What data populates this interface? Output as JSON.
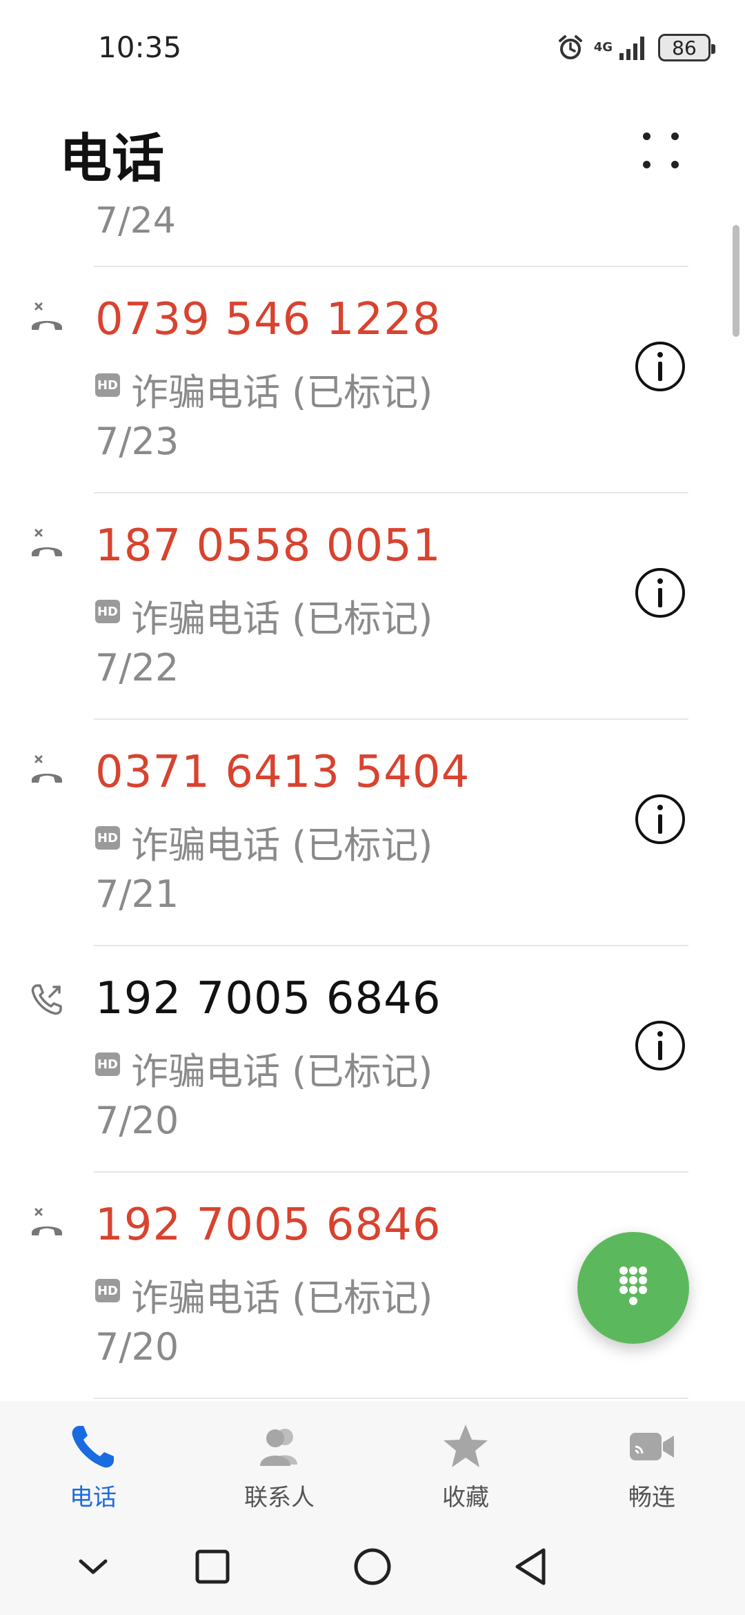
{
  "status_bar": {
    "time": "10:35",
    "network": "4G",
    "battery": "86"
  },
  "header": {
    "title": "电话"
  },
  "call_list": {
    "previous_date": "7/24",
    "items": [
      {
        "number": "0739 546 1228",
        "hd": "HD",
        "label": "诈骗电话 (已标记)",
        "date": "7/23",
        "type": "missed"
      },
      {
        "number": "187 0558 0051",
        "hd": "HD",
        "label": "诈骗电话 (已标记)",
        "date": "7/22",
        "type": "missed"
      },
      {
        "number": "0371 6413 5404",
        "hd": "HD",
        "label": "诈骗电话 (已标记)",
        "date": "7/21",
        "type": "missed"
      },
      {
        "number": "192 7005 6846",
        "hd": "HD",
        "label": "诈骗电话 (已标记)",
        "date": "7/20",
        "type": "outgoing"
      },
      {
        "number": "192 7005 6846",
        "hd": "HD",
        "label": "诈骗电话 (已标记)",
        "date": "7/20",
        "type": "missed"
      }
    ]
  },
  "bottom_nav": {
    "items": [
      {
        "label": "电话",
        "icon": "phone-icon",
        "active": true
      },
      {
        "label": "联系人",
        "icon": "contacts-icon",
        "active": false
      },
      {
        "label": "收藏",
        "icon": "star-icon",
        "active": false
      },
      {
        "label": "畅连",
        "icon": "video-call-icon",
        "active": false
      }
    ]
  },
  "colors": {
    "missed": "#d8432f",
    "accent": "#1a6be0",
    "fab": "#5cb85c",
    "secondary_text": "#8a8a8a"
  }
}
